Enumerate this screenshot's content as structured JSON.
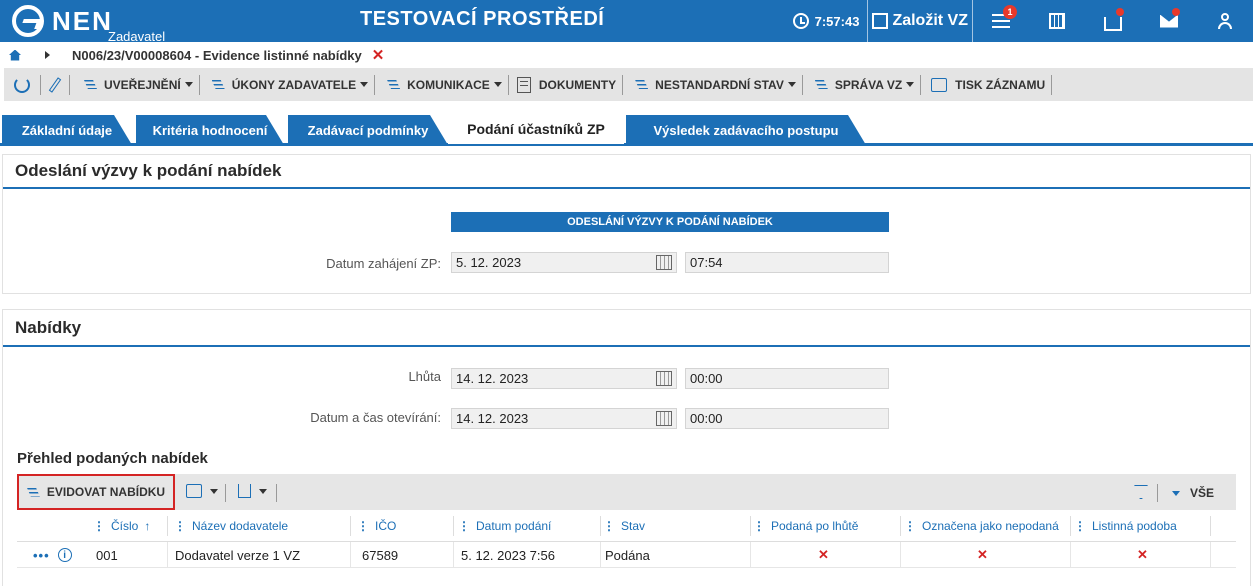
{
  "header": {
    "logo_text": "NEN",
    "logo_sub": "Zadavatel",
    "env_title": "TESTOVACÍ PROSTŘEDÍ",
    "time": "7:57:43",
    "create_label": "Založit VZ",
    "menu_badge": "1"
  },
  "breadcrumb": {
    "text": "N006/23/V00008604 - Evidence listinné nabídky"
  },
  "toolbar": {
    "items": [
      {
        "label": "UVEŘEJNĚNÍ"
      },
      {
        "label": "ÚKONY ZADAVATELE"
      },
      {
        "label": "KOMUNIKACE"
      },
      {
        "label": "DOKUMENTY"
      },
      {
        "label": "NESTANDARDNÍ STAV"
      },
      {
        "label": "SPRÁVA VZ"
      },
      {
        "label": "TISK ZÁZNAMU"
      }
    ]
  },
  "tabs": [
    {
      "label": "Základní údaje"
    },
    {
      "label": "Kritéria hodnocení"
    },
    {
      "label": "Zadávací podmínky"
    },
    {
      "label": "Podání účastníků ZP",
      "active": true
    },
    {
      "label": "Výsledek zadávacího postupu"
    }
  ],
  "section1": {
    "title": "Odeslání výzvy k podání nabídek",
    "bar": "ODESLÁNÍ VÝZVY K PODÁNÍ NABÍDEK",
    "start_label": "Datum zahájení ZP:",
    "start_date": "5. 12. 2023",
    "start_time": "07:54"
  },
  "section2": {
    "title": "Nabídky",
    "deadline_label": "Lhůta",
    "deadline_date": "14. 12. 2023",
    "deadline_time": "00:00",
    "open_label": "Datum a čas otevírání:",
    "open_date": "14. 12. 2023",
    "open_time": "00:00"
  },
  "grid": {
    "title": "Přehled podaných nabídek",
    "add_label": "EVIDOVAT NABÍDKU",
    "view_label": "VŠE",
    "columns": [
      "Číslo",
      "Název dodavatele",
      "IČO",
      "Datum podání",
      "Stav",
      "Podaná po lhůtě",
      "Označena jako nepodaná",
      "Listinná podoba"
    ],
    "rows": [
      {
        "cislo": "001",
        "nazev": "Dodavatel verze 1 VZ",
        "ico": "67589",
        "datum": "5. 12. 2023 7:56",
        "stav": "Podána",
        "po_lhute": "✕",
        "nepodana": "✕",
        "listinna": "✕"
      }
    ]
  }
}
